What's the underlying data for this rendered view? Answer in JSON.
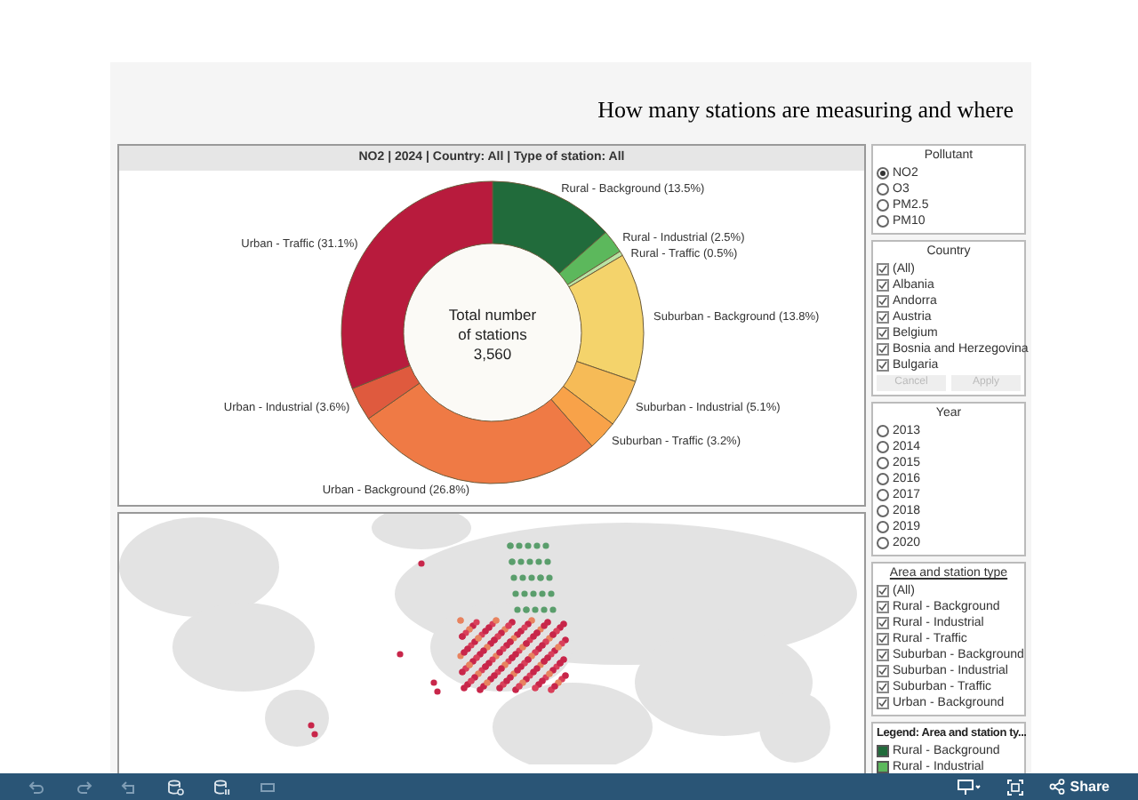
{
  "title": "How many stations are measuring and where",
  "chart_panel": {
    "header": "NO2 | 2024 | Country: All | Type of station: All",
    "center_text": [
      "Total number",
      "of stations",
      "3,560"
    ],
    "chart_data": {
      "type": "donut",
      "categories": [
        "Rural - Background (13.5%)",
        "Rural - Industrial (2.5%)",
        "Rural - Traffic (0.5%)",
        "Suburban - Background (13.8%)",
        "Suburban - Industrial (5.1%)",
        "Suburban - Traffic (3.2%)",
        "Urban - Background (26.8%)",
        "Urban - Industrial (3.6%)",
        "Urban - Traffic (31.1%)"
      ],
      "values": [
        13.5,
        2.5,
        0.5,
        13.8,
        5.1,
        3.2,
        26.8,
        3.6,
        31.1
      ],
      "colors": [
        "#216b3b",
        "#5cb85c",
        "#b9e3a4",
        "#f4d36b",
        "#f6bb57",
        "#f8a249",
        "#ef7a45",
        "#df5a3e",
        "#b81b3d"
      ]
    }
  },
  "filters": [
    {
      "kind": "radio",
      "title": "Pollutant",
      "items": [
        {
          "label": "NO2",
          "selected": true
        },
        {
          "label": "O3",
          "selected": false
        },
        {
          "label": "PM2.5",
          "selected": false
        },
        {
          "label": "PM10",
          "selected": false
        }
      ]
    },
    {
      "kind": "checkbox",
      "title": "Country",
      "items": [
        {
          "label": "(All)",
          "checked": true
        },
        {
          "label": "Albania",
          "checked": true
        },
        {
          "label": "Andorra",
          "checked": true
        },
        {
          "label": "Austria",
          "checked": true
        },
        {
          "label": "Belgium",
          "checked": true
        },
        {
          "label": "Bosnia and Herzegovina",
          "checked": true
        },
        {
          "label": "Bulgaria",
          "checked": true
        }
      ],
      "buttons": [
        {
          "label": "Cancel",
          "disabled": true
        },
        {
          "label": "Apply",
          "disabled": true
        }
      ]
    },
    {
      "kind": "radio",
      "title": "Year",
      "items": [
        {
          "label": "2013",
          "selected": false
        },
        {
          "label": "2014",
          "selected": false
        },
        {
          "label": "2015",
          "selected": false
        },
        {
          "label": "2016",
          "selected": false
        },
        {
          "label": "2017",
          "selected": false
        },
        {
          "label": "2018",
          "selected": false
        },
        {
          "label": "2019",
          "selected": false
        },
        {
          "label": "2020",
          "selected": false
        }
      ]
    },
    {
      "kind": "checkbox",
      "title": "Area and station type",
      "items": [
        {
          "label": "(All)",
          "checked": true
        },
        {
          "label": "Rural - Background",
          "checked": true
        },
        {
          "label": "Rural - Industrial",
          "checked": true
        },
        {
          "label": "Rural - Traffic",
          "checked": true
        },
        {
          "label": "Suburban - Background",
          "checked": true
        },
        {
          "label": "Suburban - Industrial",
          "checked": true
        },
        {
          "label": "Suburban - Traffic",
          "checked": true
        },
        {
          "label": "Urban - Background",
          "checked": true
        }
      ]
    },
    {
      "kind": "legend",
      "title": "Legend: Area and station ty...",
      "items": [
        {
          "label": "Rural - Background",
          "color": "#216b3b"
        },
        {
          "label": "Rural - Industrial",
          "color": "#5cb85c"
        }
      ]
    }
  ],
  "toolbar": {
    "share": "Share"
  }
}
